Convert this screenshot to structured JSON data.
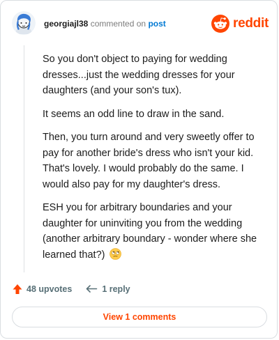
{
  "header": {
    "username": "georgiajl38",
    "commented_text": "commented on",
    "post_link": "post",
    "logo_text": "reddit",
    "brand_color": "#ff4500",
    "link_color": "#0079d3"
  },
  "comment": {
    "paragraphs": [
      "So you don't object to paying for wedding dresses...just the wedding dresses for your daughters (and your son's tux).",
      "It seems an odd line to draw in the sand.",
      "Then, you turn around and very sweetly offer to pay for another bride's dress who isn't your kid. That's lovely. I would probably do the same. I would also pay for my daughter's dress.",
      "ESH you for arbitrary boundaries and your daughter for uninviting you from the wedding (another arbitrary boundary - wonder where she learned that?)"
    ],
    "emoji_icon": "rolling-eyes-emoji"
  },
  "actions": {
    "upvotes_label": "48 upvotes",
    "upvote_icon": "upvote-arrow-icon",
    "reply_label": "1 reply",
    "reply_icon": "reply-arrow-icon"
  },
  "footer": {
    "view_comments_label": "View 1 comments"
  }
}
